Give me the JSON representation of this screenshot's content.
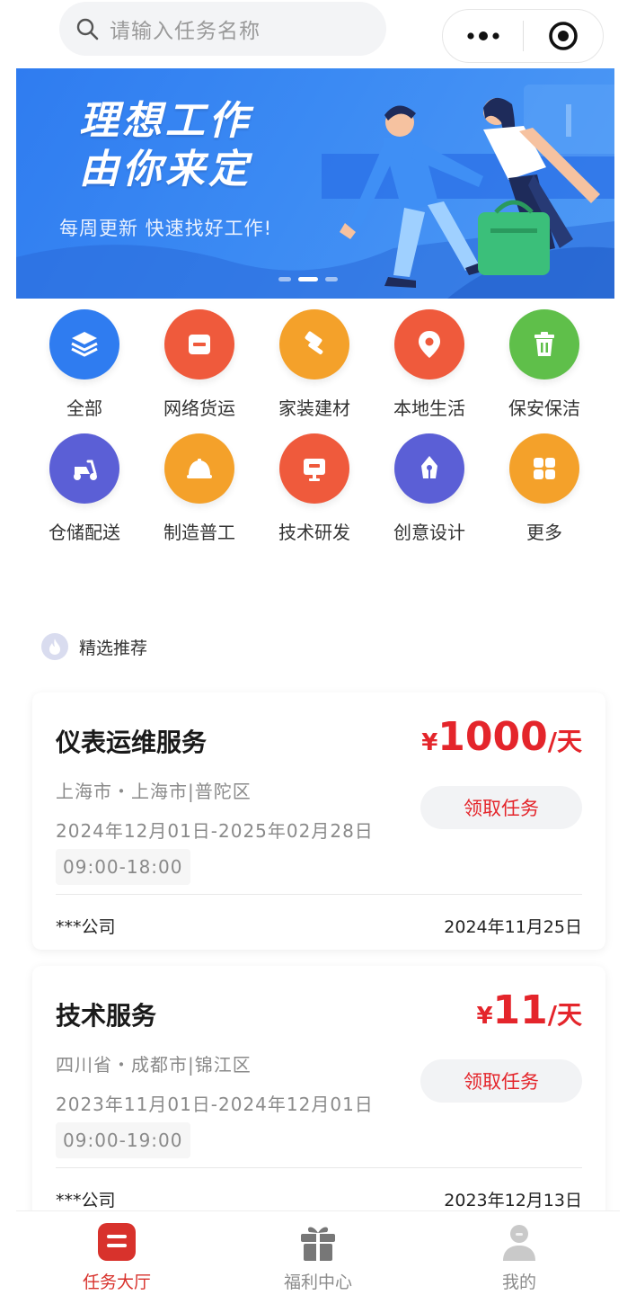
{
  "search": {
    "placeholder": "请输入任务名称"
  },
  "banner": {
    "title_line1": "理想工作",
    "title_line2": "由你来定",
    "subtitle": "每周更新 快速找好工作!"
  },
  "categories": [
    {
      "label": "全部",
      "icon": "layers-icon",
      "color": "#2f7cf0"
    },
    {
      "label": "网络货运",
      "icon": "card-icon",
      "color": "#ef5a3c"
    },
    {
      "label": "家装建材",
      "icon": "hammer-icon",
      "color": "#f4a12a"
    },
    {
      "label": "本地生活",
      "icon": "location-pin-icon",
      "color": "#ef5a3c"
    },
    {
      "label": "保安保洁",
      "icon": "trash-icon",
      "color": "#5fbf4a"
    },
    {
      "label": "仓储配送",
      "icon": "scooter-icon",
      "color": "#5b5fd6"
    },
    {
      "label": "制造普工",
      "icon": "hard-hat-icon",
      "color": "#f4a12a"
    },
    {
      "label": "技术研发",
      "icon": "monitor-icon",
      "color": "#ef5a3c"
    },
    {
      "label": "创意设计",
      "icon": "pen-nib-icon",
      "color": "#5b5fd6"
    },
    {
      "label": "更多",
      "icon": "grid-icon",
      "color": "#f4a12a"
    }
  ],
  "section": {
    "title": "精选推荐"
  },
  "jobs": [
    {
      "title": "仪表运维服务",
      "currency": "¥",
      "price": "1000",
      "unit": "/天",
      "location": "上海市・上海市|普陀区",
      "date_range": "2024年12月01日-2025年02月28日",
      "hours": "09:00-18:00",
      "button": "领取任务",
      "company": "***公司",
      "posted": "2024年11月25日"
    },
    {
      "title": "技术服务",
      "currency": "¥",
      "price": "11",
      "unit": "/天",
      "location": "四川省・成都市|锦江区",
      "date_range": "2023年11月01日-2024年12月01日",
      "hours": "09:00-19:00",
      "button": "领取任务",
      "company": "***公司",
      "posted": "2023年12月13日"
    }
  ],
  "tabbar": [
    {
      "label": "任务大厅",
      "icon": "task-hall-icon",
      "active": true
    },
    {
      "label": "福利中心",
      "icon": "gift-icon",
      "active": false
    },
    {
      "label": "我的",
      "icon": "user-icon",
      "active": false
    }
  ],
  "colors": {
    "accent_red": "#e4252b",
    "banner_blue": "#2f7cf0"
  }
}
